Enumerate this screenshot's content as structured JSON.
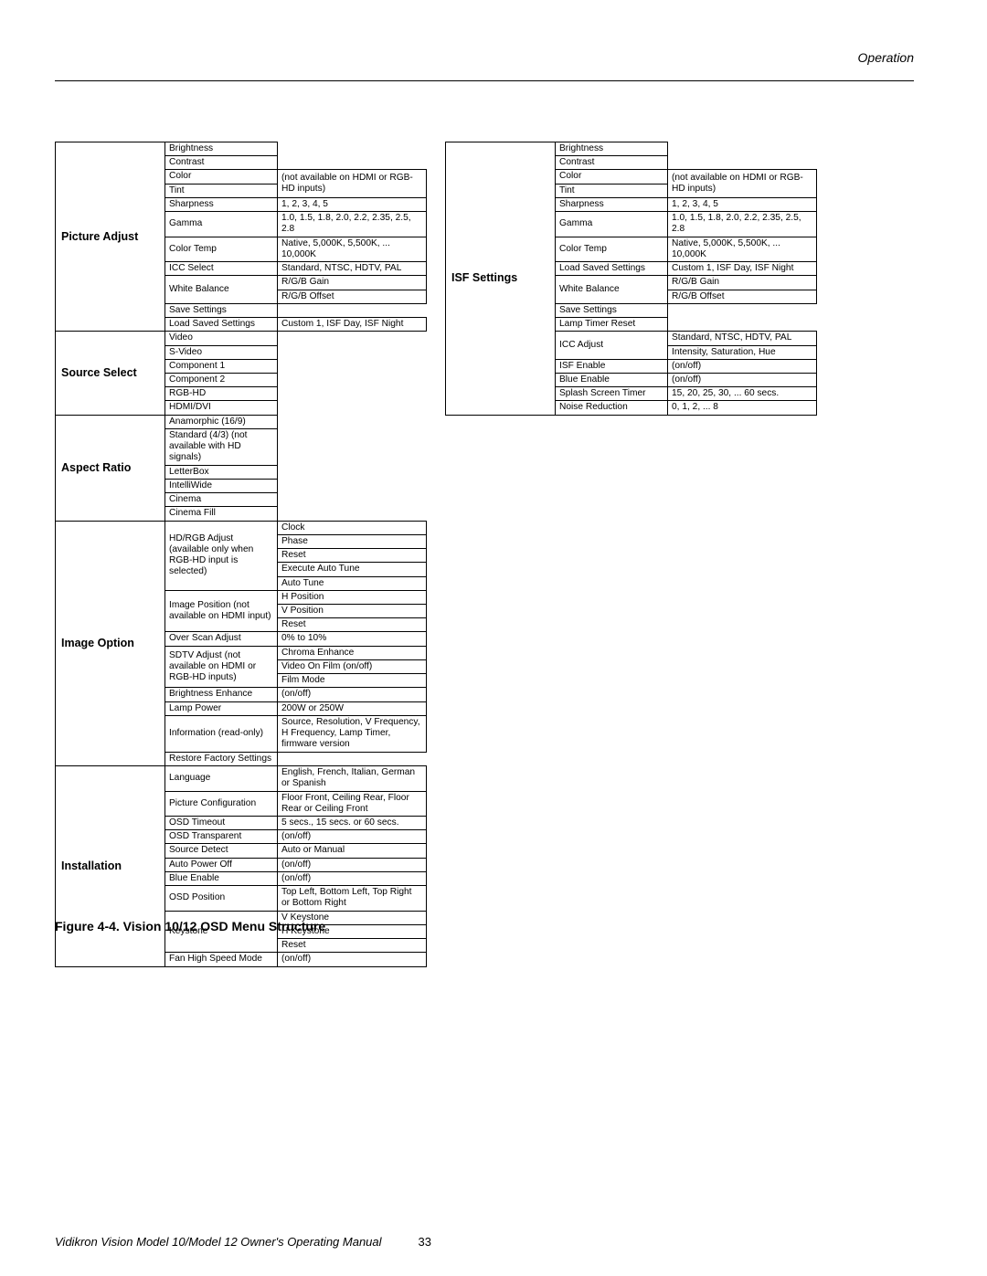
{
  "header_section": "Operation",
  "figure_caption": "Figure 4-4. Vision 10/12 OSD Menu Structure",
  "footer": {
    "manual": "Vidikron Vision Model 10/Model 12 Owner's Operating Manual",
    "page": "33"
  },
  "left": {
    "picture_adjust": {
      "title": "Picture Adjust",
      "r": [
        [
          "Brightness",
          ""
        ],
        [
          "Contrast",
          ""
        ],
        [
          "Color",
          "(not available on HDMI or RGB-HD inputs)"
        ],
        [
          "Tint",
          ""
        ],
        [
          "Sharpness",
          "1, 2, 3, 4, 5"
        ],
        [
          "Gamma",
          "1.0, 1.5, 1.8, 2.0, 2.2, 2.35, 2.5, 2.8"
        ],
        [
          "Color Temp",
          "Native, 5,000K, 5,500K, ... 10,000K"
        ],
        [
          "ICC Select",
          "Standard, NTSC, HDTV, PAL"
        ],
        [
          "White Balance",
          "R/G/B Gain"
        ],
        [
          "",
          "R/G/B Offset"
        ],
        [
          "Save Settings",
          ""
        ],
        [
          "Load Saved Settings",
          "Custom 1, ISF Day, ISF Night"
        ]
      ]
    },
    "source_select": {
      "title": "Source Select",
      "r": [
        "Video",
        "S-Video",
        "Component 1",
        "Component 2",
        "RGB-HD",
        "HDMI/DVI"
      ]
    },
    "aspect_ratio": {
      "title": "Aspect Ratio",
      "r": [
        "Anamorphic (16/9)",
        "Standard (4/3) (not available with HD signals)",
        "LetterBox",
        "IntelliWide",
        "Cinema",
        "Cinema Fill"
      ]
    },
    "image_option": {
      "title": "Image Option",
      "hd_rgb_adjust": "HD/RGB Adjust (available only when RGB-HD input is selected)",
      "hd_rgb_items": [
        "Clock",
        "Phase",
        "Reset",
        "Execute Auto Tune",
        "Auto Tune"
      ],
      "image_position": "Image Position (not available on HDMI input)",
      "image_position_items": [
        "H Position",
        "V Position",
        "Reset"
      ],
      "over_scan": [
        "Over Scan Adjust",
        "0% to 10%"
      ],
      "sdtv_adjust": "SDTV Adjust (not available on HDMI or RGB-HD inputs)",
      "sdtv_items": [
        "Chroma Enhance",
        "Video On Film (on/off)",
        "Film Mode"
      ],
      "brightness_enhance": [
        "Brightness Enhance",
        "(on/off)"
      ],
      "lamp_power": [
        "Lamp Power",
        "200W or 250W"
      ],
      "information": [
        "Information (read-only)",
        "Source, Resolution, V Frequency, H Frequency, Lamp Timer, firmware version"
      ],
      "restore": "Restore Factory Settings"
    },
    "installation": {
      "title": "Installation",
      "r": [
        [
          "Language",
          "English, French, Italian, German or Spanish"
        ],
        [
          "Picture Configuration",
          "Floor Front, Ceiling Rear, Floor Rear or Ceiling Front"
        ],
        [
          "OSD Timeout",
          "5 secs., 15 secs. or 60 secs."
        ],
        [
          "OSD Transparent",
          "(on/off)"
        ],
        [
          "Source Detect",
          "Auto or Manual"
        ],
        [
          "Auto Power Off",
          "(on/off)"
        ],
        [
          "Blue Enable",
          "(on/off)"
        ],
        [
          "OSD Position",
          "Top Left, Bottom Left, Top Right or Bottom Right"
        ]
      ],
      "keystone": "Keystone",
      "keystone_items": [
        "V Keystone",
        "H Keystone",
        "Reset"
      ],
      "fan": [
        "Fan High Speed Mode",
        "(on/off)"
      ]
    }
  },
  "right": {
    "isf_settings": {
      "title": "ISF Settings",
      "r1": [
        [
          "Brightness",
          ""
        ],
        [
          "Contrast",
          ""
        ],
        [
          "Color",
          "(not available on HDMI or RGB-HD inputs)"
        ],
        [
          "Tint",
          ""
        ],
        [
          "Sharpness",
          "1, 2, 3, 4, 5"
        ],
        [
          "Gamma",
          "1.0, 1.5, 1.8, 2.0, 2.2, 2.35, 2.5, 2.8"
        ],
        [
          "Color Temp",
          "Native, 5,000K, 5,500K, ... 10,000K"
        ],
        [
          "Load Saved Settings",
          "Custom 1, ISF Day, ISF Night"
        ],
        [
          "White Balance",
          "R/G/B Gain"
        ],
        [
          "",
          "R/G/B Offset"
        ],
        [
          "Save Settings",
          ""
        ],
        [
          "Lamp Timer Reset",
          ""
        ]
      ],
      "icc": "ICC Adjust",
      "icc_items": [
        "Standard, NTSC, HDTV, PAL",
        "Intensity, Saturation, Hue"
      ],
      "r2": [
        [
          "ISF Enable",
          "(on/off)"
        ],
        [
          "Blue Enable",
          "(on/off)"
        ],
        [
          "Splash Screen Timer",
          "15, 20, 25, 30, ... 60 secs."
        ],
        [
          "Noise Reduction",
          "0, 1, 2, ... 8"
        ]
      ]
    }
  }
}
